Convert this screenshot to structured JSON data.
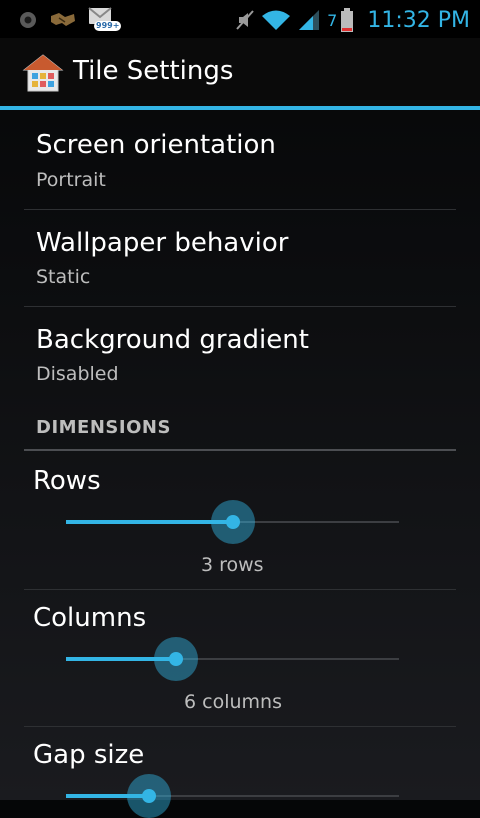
{
  "status_bar": {
    "icons": [
      "circle-icon",
      "handshake-icon",
      "gmail-icon",
      "mute-icon",
      "wifi-icon",
      "signal-icon",
      "battery-icon"
    ],
    "gmail_badge": "999+",
    "battery_level": "7",
    "time": "11:32 PM",
    "accent": "#33b5e5"
  },
  "action_bar": {
    "title": "Tile Settings"
  },
  "preferences": [
    {
      "title": "Screen orientation",
      "summary": "Portrait"
    },
    {
      "title": "Wallpaper behavior",
      "summary": "Static"
    },
    {
      "title": "Background gradient",
      "summary": "Disabled"
    }
  ],
  "section": {
    "header": "DIMENSIONS"
  },
  "sliders": [
    {
      "title": "Rows",
      "value_label": "3 rows",
      "fraction": 0.5
    },
    {
      "title": "Columns",
      "value_label": "6 columns",
      "fraction": 0.33
    },
    {
      "title": "Gap size",
      "value_label": "",
      "fraction": 0.25
    }
  ]
}
